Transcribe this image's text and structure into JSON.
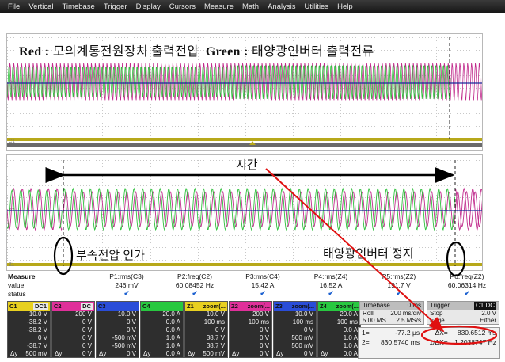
{
  "menu": [
    "File",
    "Vertical",
    "Timebase",
    "Trigger",
    "Display",
    "Cursors",
    "Measure",
    "Math",
    "Analysis",
    "Utilities",
    "Help"
  ],
  "caption": {
    "red_label": "Red :",
    "red_text": "모의계통전원장치 출력전압",
    "green_label": "Green :",
    "green_text": "태양광인버터 출력전류"
  },
  "annotations": {
    "time": "시간",
    "undervoltage": "부족전압 인가",
    "inverter_stop": "태양광인버터 정지"
  },
  "measure": {
    "header": "Measure",
    "row_value": "value",
    "row_status": "status",
    "params": [
      {
        "name": "P1:rms(C3)",
        "value": "246 mV"
      },
      {
        "name": "P2:freq(C2)",
        "value": "60.08452 Hz"
      },
      {
        "name": "P3:rms(C4)",
        "value": "15.42 A"
      },
      {
        "name": "P4:rms(Z4)",
        "value": "16.52 A"
      },
      {
        "name": "P5:rms(Z2)",
        "value": "191.7 V"
      },
      {
        "name": "P6:freq(Z2)",
        "value": "60.06314 Hz"
      }
    ]
  },
  "channels": [
    {
      "id": "C1",
      "coupling": "DC1",
      "color": "#e8d020",
      "lines": [
        [
          "",
          "10.0 V"
        ],
        [
          "",
          "-38.2 V"
        ],
        [
          "",
          "-38.2 V"
        ],
        [
          "",
          "0 V"
        ],
        [
          "",
          "-38.7 V"
        ],
        [
          "Δy",
          "500 mV"
        ]
      ]
    },
    {
      "id": "C2",
      "coupling": "DC",
      "color": "#e0309a",
      "lines": [
        [
          "",
          "200 V"
        ],
        [
          "",
          "0 V"
        ],
        [
          "",
          "0 V"
        ],
        [
          "",
          "0 V"
        ],
        [
          "",
          "0 V"
        ],
        [
          "Δy",
          "0 V"
        ]
      ]
    },
    {
      "id": "C3",
      "coupling": "",
      "color": "#2a4dd8",
      "lines": [
        [
          "",
          "10.0 V"
        ],
        [
          "",
          "0 V"
        ],
        [
          "",
          "0 V"
        ],
        [
          "",
          "-500 mV"
        ],
        [
          "",
          "-500 mV"
        ],
        [
          "Δy",
          "0 V"
        ]
      ]
    },
    {
      "id": "C4",
      "coupling": "",
      "color": "#28c840",
      "lines": [
        [
          "",
          "20.0 A"
        ],
        [
          "",
          "0.0 A"
        ],
        [
          "",
          "0.0 A"
        ],
        [
          "",
          "1.0 A"
        ],
        [
          "",
          "1.0 A"
        ],
        [
          "Δy",
          "0.0 A"
        ]
      ]
    },
    {
      "id": "Z1",
      "coupling": "zoom(...",
      "color": "#e8d020",
      "lines": [
        [
          "",
          "10.0 V"
        ],
        [
          "",
          "100 ms"
        ],
        [
          "",
          "0 V"
        ],
        [
          "",
          "38.7 V"
        ],
        [
          "",
          "38.7 V"
        ],
        [
          "Δy",
          "500 mV"
        ]
      ]
    },
    {
      "id": "Z2",
      "coupling": "zoom(...",
      "color": "#e0309a",
      "lines": [
        [
          "",
          "200 V"
        ],
        [
          "",
          "100 ms"
        ],
        [
          "",
          "0 V"
        ],
        [
          "",
          "0 V"
        ],
        [
          "",
          "0 V"
        ],
        [
          "Δy",
          "0 V"
        ]
      ]
    },
    {
      "id": "Z3",
      "coupling": "zoom(...",
      "color": "#2a4dd8",
      "lines": [
        [
          "",
          "10.0 V"
        ],
        [
          "",
          "100 ms"
        ],
        [
          "",
          "0 V"
        ],
        [
          "",
          "500 mV"
        ],
        [
          "",
          "500 mV"
        ],
        [
          "Δy",
          "0 V"
        ]
      ]
    },
    {
      "id": "Z4",
      "coupling": "zoom(...",
      "color": "#28c840",
      "lines": [
        [
          "",
          "20.0 A"
        ],
        [
          "",
          "100 ms"
        ],
        [
          "",
          "0.0 A"
        ],
        [
          "",
          "1.0 A"
        ],
        [
          "",
          "1.0 A"
        ],
        [
          "Δy",
          "0.0 A"
        ]
      ]
    }
  ],
  "timebase": {
    "label": "Timebase",
    "value": "0 ms",
    "mode": "Roll",
    "rate": "200 ms/div",
    "samples": "5.00 MS",
    "sample_rate": "2.5 MS/s"
  },
  "trigger": {
    "label": "Trigger",
    "channel": "C1 DC",
    "mode": "Stop",
    "level": "2.0 V",
    "type": "Edge",
    "slope": "Either"
  },
  "cursors": {
    "x1_label": "1=",
    "x1": "-77.2 μs",
    "delta_label": "ΔX=",
    "delta": "830.6512 ms",
    "x2_label": "2=",
    "x2": "830.5740 ms",
    "inv_label": "1/ΔX=",
    "inv": "1.2038747 Hz"
  }
}
